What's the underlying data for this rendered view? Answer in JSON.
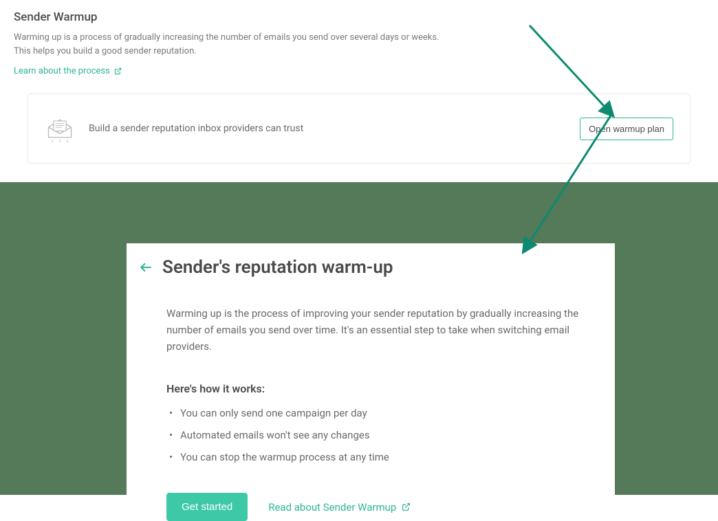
{
  "colors": {
    "accent": "#2fb39b",
    "primary_btn": "#3dc8a8",
    "backdrop": "#547a5a"
  },
  "top": {
    "title": "Sender Warmup",
    "description": "Warming up is a process of gradually increasing the number of emails you send over several days or weeks. This helps you build a good sender reputation.",
    "learn_link": "Learn about the process"
  },
  "card": {
    "icon": "envelope-open-icon",
    "text": "Build a sender reputation inbox providers can trust",
    "button_label": "Open warmup plan"
  },
  "modal": {
    "title": "Sender's reputation warm-up",
    "description": "Warming up is the process of improving your sender reputation by gradually increasing the number of emails you send over time. It's an essential step to take when switching email providers.",
    "how_title": "Here's how it works:",
    "bullets": [
      "You can only send one campaign per day",
      "Automated emails won't see any changes",
      "You can stop the warmup process at any time"
    ],
    "primary_button": "Get started",
    "read_link": "Read about Sender Warmup"
  }
}
